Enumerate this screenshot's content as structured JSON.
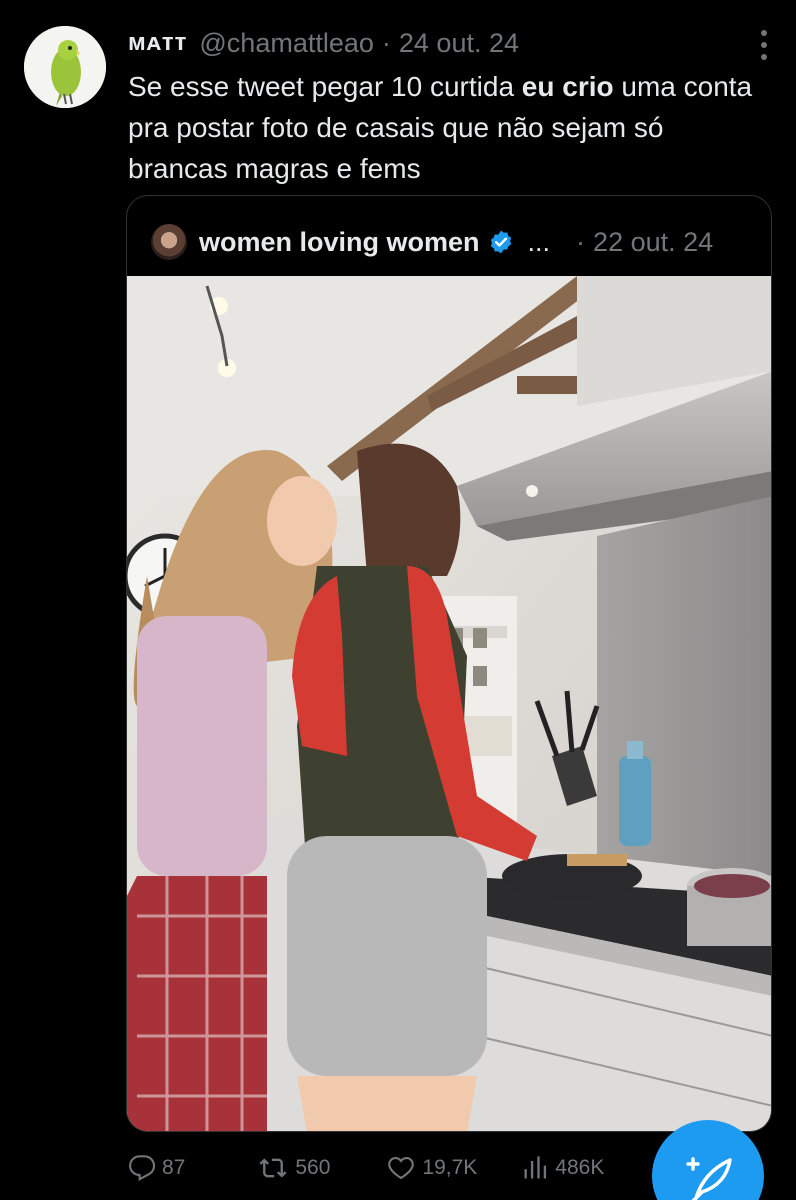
{
  "tweet": {
    "author_name": "ᴍᴀᴛᴛ",
    "handle": "@chamattleao",
    "separator": "·",
    "date": "24 out. 24",
    "text_part1": "Se esse tweet pegar 10 curtida ",
    "text_bold": "eu crio",
    "text_part2": " uma conta pra postar foto de casais que não sejam só brancas magras e fems"
  },
  "quoted": {
    "author_name": "women loving women",
    "ellipsis": "...",
    "separator": "·",
    "date": "22 out. 24",
    "verified": true
  },
  "stats": {
    "replies": "87",
    "retweets": "560",
    "likes": "19,7K",
    "views": "486K"
  },
  "icons": {
    "more": "more-vertical-icon",
    "reply": "reply-icon",
    "retweet": "retweet-icon",
    "like": "heart-icon",
    "views": "views-chart-icon",
    "compose": "compose-feather-icon",
    "verified": "verified-badge-icon"
  },
  "colors": {
    "background": "#000000",
    "text": "#e7e9ea",
    "muted": "#71767b",
    "accent": "#1d9bf0",
    "border": "#2f3336"
  }
}
